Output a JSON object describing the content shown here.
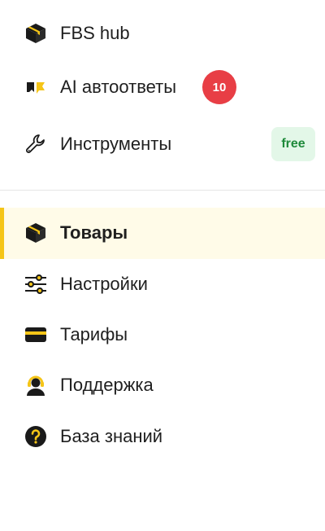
{
  "sidebar": {
    "top_items": [
      {
        "label": "FBS hub",
        "icon": "box-icon"
      },
      {
        "label": "AI автоответы",
        "icon": "flags-icon",
        "badge": "10"
      },
      {
        "label": "Инструменты",
        "icon": "wrench-icon",
        "badge": "free"
      }
    ],
    "main_items": [
      {
        "label": "Товары",
        "icon": "box-icon",
        "active": true
      },
      {
        "label": "Настройки",
        "icon": "sliders-icon"
      },
      {
        "label": "Тарифы",
        "icon": "card-icon"
      },
      {
        "label": "Поддержка",
        "icon": "headset-user-icon"
      },
      {
        "label": "База знаний",
        "icon": "question-circle-icon"
      }
    ]
  },
  "colors": {
    "accent": "#f5c518",
    "active_bg": "#fffbe8",
    "badge_red": "#e83e45",
    "free_bg": "#e3f7e8",
    "free_text": "#1f8a3b",
    "text": "#1f1f1f"
  }
}
